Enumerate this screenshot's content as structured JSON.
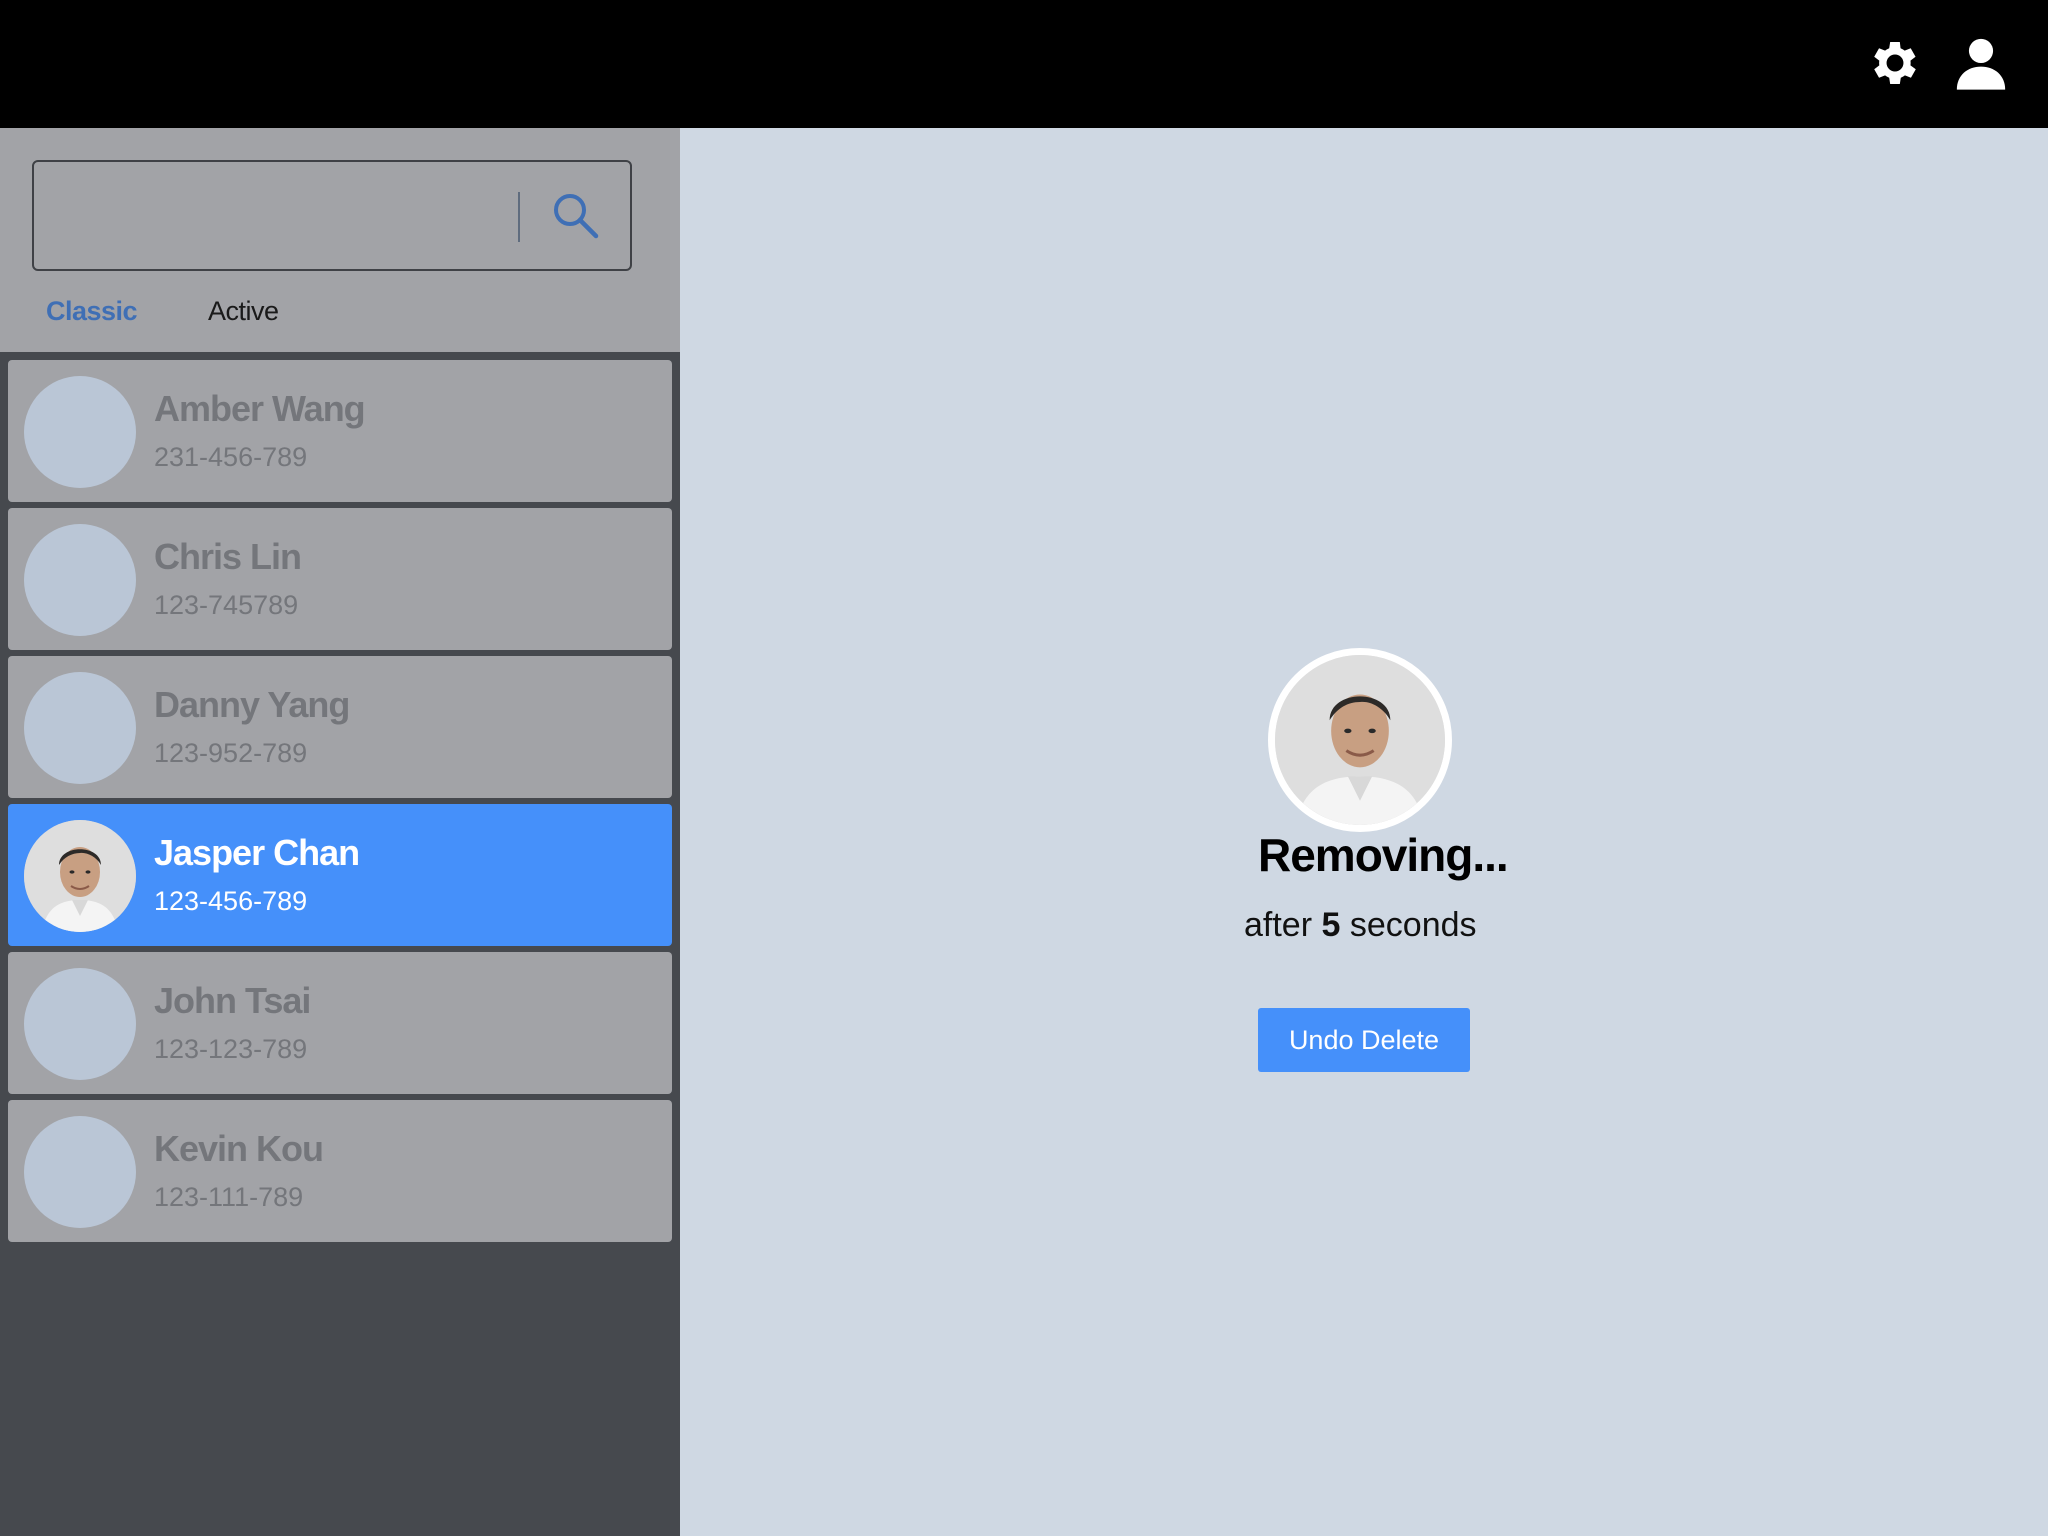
{
  "topbar": {
    "settings_icon": "gear-icon",
    "profile_icon": "user-icon",
    "background": "#000000"
  },
  "search": {
    "value": "",
    "placeholder": "",
    "icon": "search-icon",
    "accent": "#3f6fb5"
  },
  "tabs": [
    {
      "label": "Classic",
      "selected": true
    },
    {
      "label": "Active",
      "selected": false
    }
  ],
  "contacts": [
    {
      "name": "Amber Wang",
      "phone": "231-456-789",
      "selected": false
    },
    {
      "name": "Chris Lin",
      "phone": "123-745789",
      "selected": false
    },
    {
      "name": "Danny Yang",
      "phone": "123-952-789",
      "selected": false
    },
    {
      "name": "Jasper Chan",
      "phone": "123-456-789",
      "selected": true
    },
    {
      "name": "John Tsai",
      "phone": "123-123-789",
      "selected": false
    },
    {
      "name": "Kevin Kou",
      "phone": "123-111-789",
      "selected": false
    }
  ],
  "removal": {
    "title": "Removing...",
    "sub_prefix": "after",
    "seconds": "5",
    "sub_suffix": "seconds",
    "undo_label": "Undo Delete"
  },
  "colors": {
    "selected": "#4590fa",
    "list_bg": "#a2a3a7",
    "main_bg": "#cfd8e3"
  }
}
